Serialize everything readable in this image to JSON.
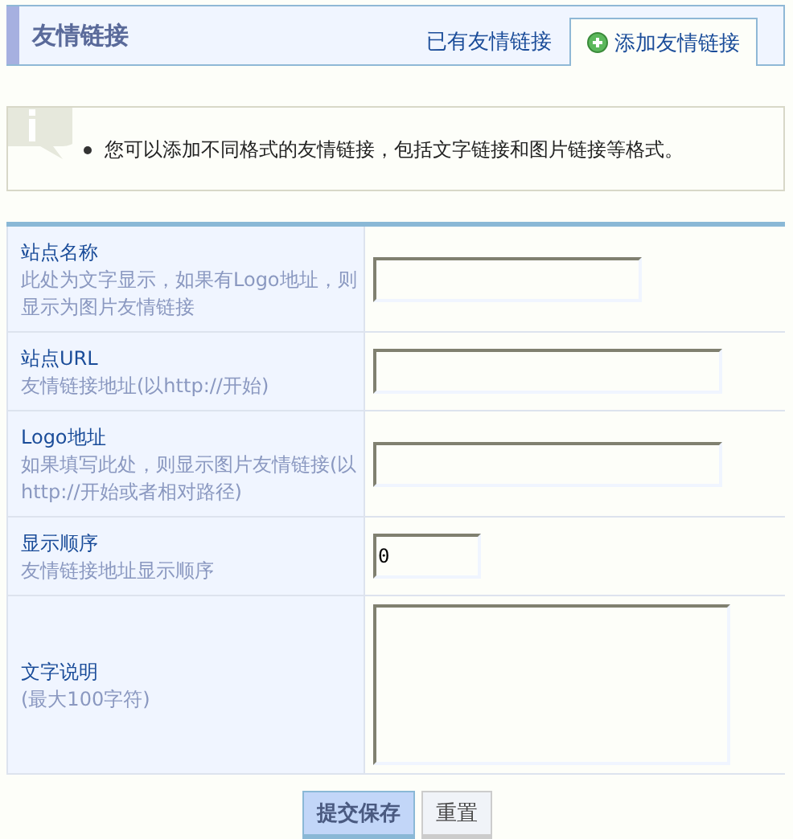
{
  "header": {
    "title": "友情链接"
  },
  "tabs": [
    {
      "label": "已有友情链接",
      "selected": false,
      "kind": "list"
    },
    {
      "label": "添加友情链接",
      "selected": true,
      "kind": "add"
    }
  ],
  "notice": {
    "items": [
      "您可以添加不同格式的友情链接，包括文字链接和图片链接等格式。"
    ]
  },
  "form": {
    "rows": [
      {
        "label": "站点名称",
        "hint": "此处为文字显示，如果有Logo地址，则显示为图片友情链接",
        "kind": "text"
      },
      {
        "label": "站点URL",
        "hint": "友情链接地址(以http://开始)",
        "kind": "text"
      },
      {
        "label": "Logo地址",
        "hint": "如果填写此处，则显示图片友情链接(以http://开始或者相对路径)",
        "kind": "text"
      },
      {
        "label": "显示顺序",
        "hint": "友情链接地址显示顺序",
        "kind": "text",
        "value": "0"
      },
      {
        "label": "文字说明",
        "hint": "(最大100字符)",
        "kind": "textarea"
      }
    ]
  },
  "buttons": [
    {
      "label": "提交保存",
      "kind": "primary"
    },
    {
      "label": "重置",
      "kind": "secondary"
    }
  ]
}
